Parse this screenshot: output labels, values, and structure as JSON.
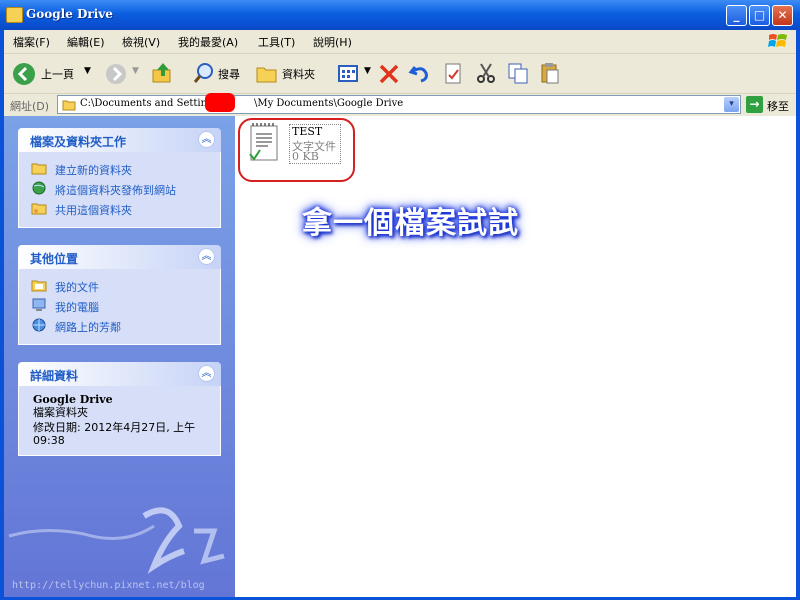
{
  "window": {
    "title": "Google Drive",
    "min_glyph": "_",
    "max_glyph": "□",
    "close_glyph": "✕"
  },
  "menu": [
    "檔案(F)",
    "編輯(E)",
    "檢視(V)",
    "我的最愛(A)",
    "工具(T)",
    "說明(H)"
  ],
  "toolbar": {
    "back_label": "上一頁",
    "search_label": "搜尋",
    "folders_label": "資料夾"
  },
  "address": {
    "label": "網址(D)",
    "path_prefix": "C:\\Documents and Settings\\",
    "path_suffix": "\\My Documents\\Google Drive",
    "go_label": "移至",
    "dropdown_glyph": "▾",
    "go_glyph": "→"
  },
  "sidebar": {
    "collapse_glyph": "︽",
    "file_tasks": {
      "title": "檔案及資料夾工作",
      "items": [
        "建立新的資料夾",
        "將這個資料夾發佈到網站",
        "共用這個資料夾"
      ]
    },
    "other_places": {
      "title": "其他位置",
      "items": [
        "我的文件",
        "我的電腦",
        "網路上的芳鄰"
      ]
    },
    "details": {
      "title": "詳細資料",
      "name": "Google Drive",
      "type": "檔案資料夾",
      "modified": "修改日期: 2012年4月27日, 上午 09:38"
    },
    "watermark_url": "http://tellychun.pixnet.net/blog"
  },
  "file": {
    "name": "TEST",
    "type": "文字文件",
    "size": "0 KB"
  },
  "annotation": "拿一個檔案試試",
  "colors": {
    "title_bar": "#0b5ee0",
    "sidebar": "#7ba2e7",
    "panel_title": "#215dc6",
    "highlight": "#d62020"
  }
}
